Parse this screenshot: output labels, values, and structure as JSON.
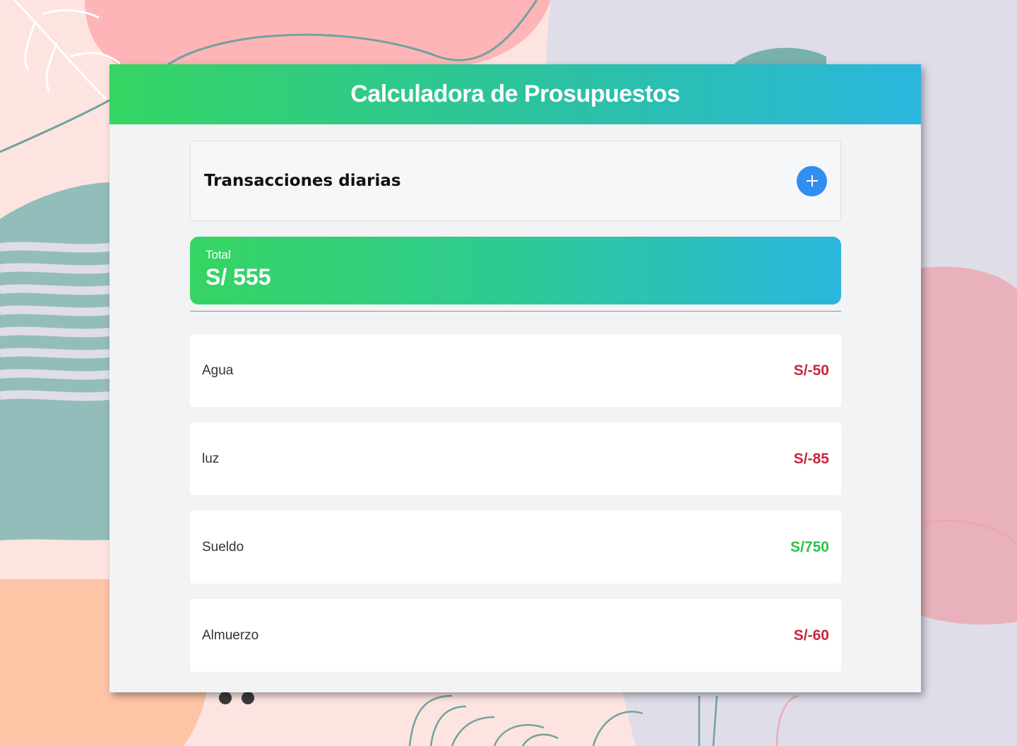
{
  "app": {
    "title": "Calculadora de Prosupuestos"
  },
  "transactions_panel": {
    "title": "Transacciones diarias",
    "add_icon": "plus-icon"
  },
  "total": {
    "label": "Total",
    "value": "S/ 555"
  },
  "transactions": [
    {
      "name": "Agua",
      "amount": "S/-50",
      "type": "expense"
    },
    {
      "name": "luz",
      "amount": "S/-85",
      "type": "expense"
    },
    {
      "name": "Sueldo",
      "amount": "S/750",
      "type": "income"
    },
    {
      "name": "Almuerzo",
      "amount": "S/-60",
      "type": "expense"
    }
  ],
  "colors": {
    "accent_green": "#35d562",
    "accent_blue": "#2bb6de",
    "add_button": "#2f8ef0",
    "expense": "#c8283c",
    "income": "#2ec24a"
  }
}
